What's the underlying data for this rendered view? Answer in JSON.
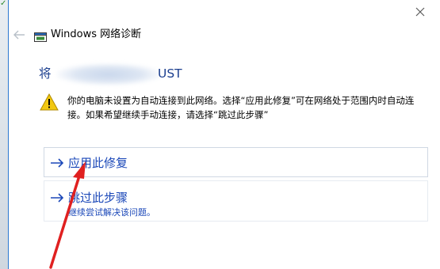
{
  "window": {
    "title": "Windows 网络诊断"
  },
  "content": {
    "heading_prefix": "将",
    "heading_suffix": "UST",
    "message": "你的电脑未设置为自动连接到此网络。选择“应用此修复”可在网络处于范围内时自动连接。如果希望继续手动连接，请选择“跳过此步骤”"
  },
  "options": [
    {
      "label": "应用此修复"
    },
    {
      "label": "跳过此步骤",
      "sublabel": "继续尝试解决该问题。"
    }
  ],
  "colors": {
    "accent": "#1a47b8",
    "heading": "#1c3f8f",
    "warning": "#f2c811",
    "annotation": "#e02020"
  },
  "icons": {
    "close": "close-icon",
    "back": "back-arrow-icon",
    "app": "network-diagnostics-icon",
    "warning": "warning-icon",
    "option_arrow": "arrow-right-icon"
  }
}
